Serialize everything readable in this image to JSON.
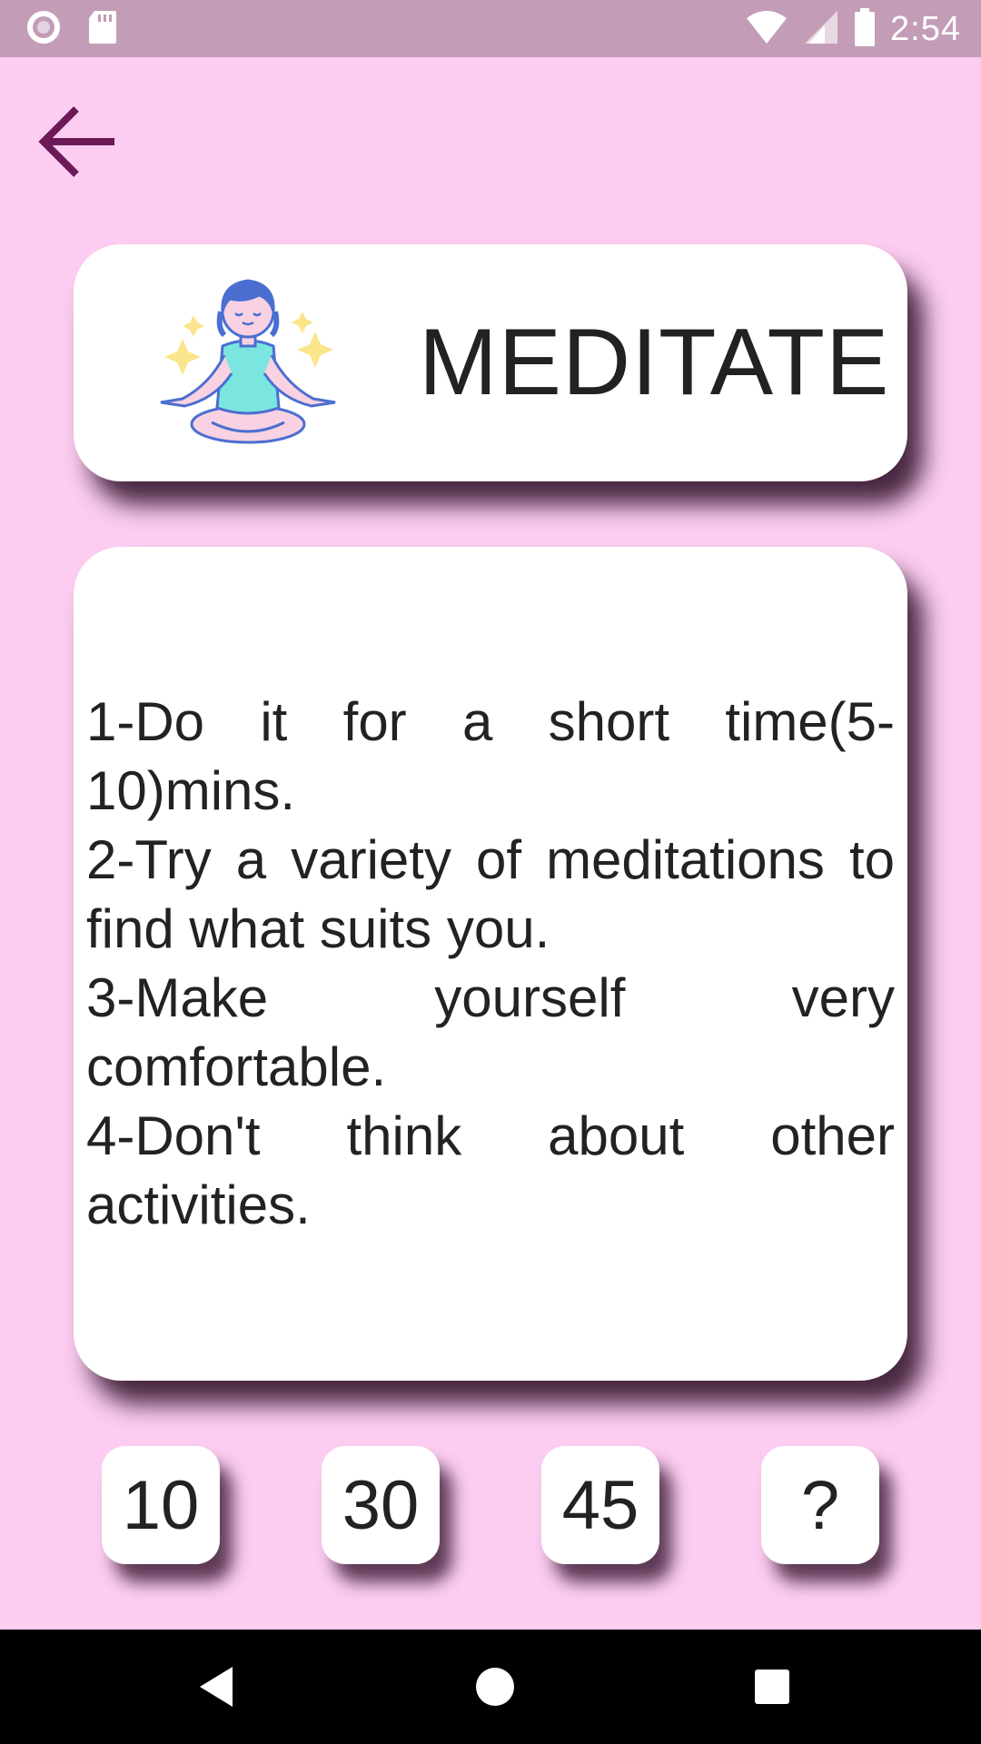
{
  "status_bar": {
    "time": "2:54",
    "icons": [
      "circle-notification-icon",
      "sd-card-icon",
      "wifi-icon",
      "cell-signal-icon",
      "battery-icon"
    ]
  },
  "header": {
    "back_icon": "arrow-left-icon"
  },
  "title_card": {
    "illustration": "meditating-person-icon",
    "title": "MEDITATE"
  },
  "tips": [
    "1-Do it for a short time(5-10)mins.",
    "2-Try a variety of meditations to find what suits you.",
    "3-Make yourself very comfortable.",
    "4-Don't think about other activities."
  ],
  "durations": [
    "10",
    "30",
    "45",
    "?"
  ],
  "nav_bar": {
    "back": "nav-back-icon",
    "home": "nav-home-icon",
    "recent": "nav-recent-icon"
  },
  "colors": {
    "background": "#fccdf0",
    "status_bar": "#c39db8",
    "accent": "#6b1a57",
    "card": "#ffffff"
  }
}
